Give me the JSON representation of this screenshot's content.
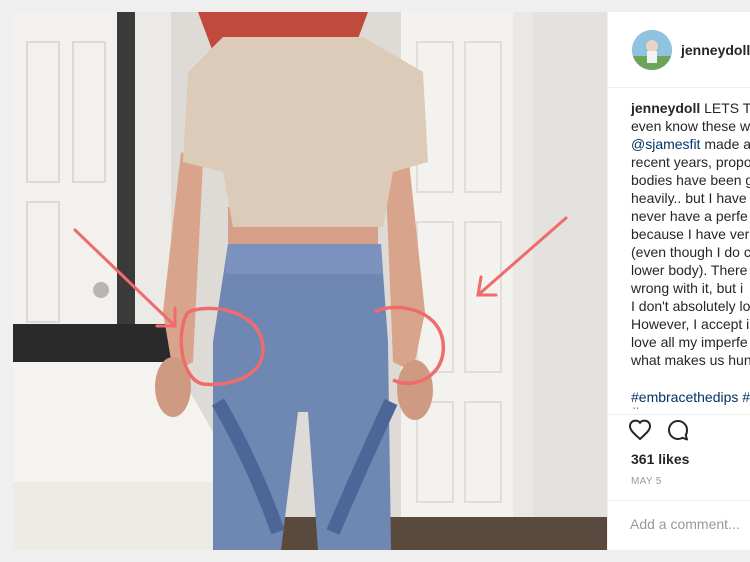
{
  "post": {
    "username": "jenneydoll",
    "caption_username": "jenneydoll",
    "caption_lines": [
      "LETS TA",
      "even know these w",
      "@sjamesfit",
      " made a",
      "recent years, propo",
      "bodies have been g",
      "heavily.. but I have",
      "never have a perfe",
      "because I have ver",
      "(even though I do c",
      "lower body). There",
      "wrong with it, but i",
      "I don't absolutely lo",
      "However, I accept i",
      "love all my imperfe",
      "what makes us hun"
    ],
    "hashtag_line": "#embracethedips #",
    "hashtag_line2": "#... ...",
    "likes": "361 likes",
    "date": "MAY 5",
    "comment_placeholder": "Add a comment..."
  },
  "icons": {
    "like": "heart-outline-icon",
    "comment": "speech-bubble-icon"
  },
  "colors": {
    "annotation": "#f06b6b",
    "link": "#003569",
    "text": "#262626",
    "muted": "#999999"
  }
}
